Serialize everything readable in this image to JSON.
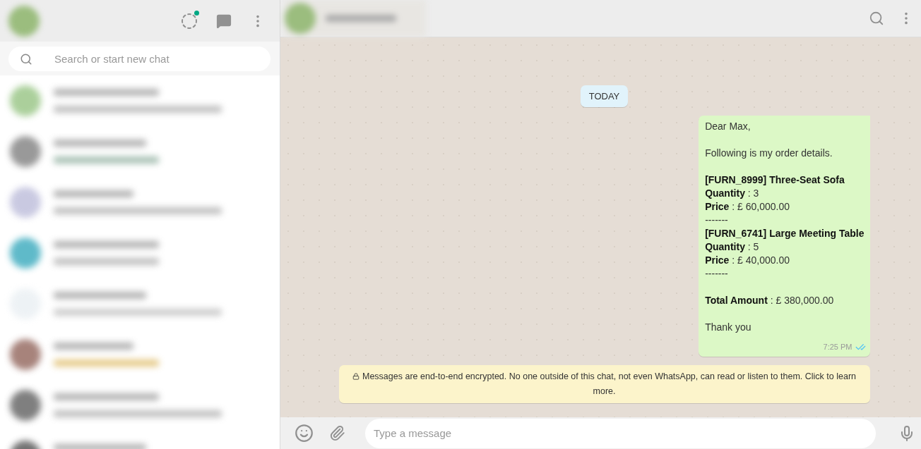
{
  "sidebar": {
    "search": {
      "placeholder": "Search or start new chat"
    },
    "status_unread": true
  },
  "chat": {
    "date_divider": "TODAY",
    "message": {
      "paragraphs": [
        [
          "Dear Max,"
        ],
        [
          "Following is my order details."
        ],
        [
          "**[FURN_8999] Three-Seat Sofa**",
          "**Quantity** : 3",
          "**Price** : £ 60,000.00",
          "-------",
          "**[FURN_6741] Large Meeting Table**",
          "**Quantity** : 5",
          "**Price** : £ 40,000.00",
          "-------"
        ],
        [
          "**Total Amount** : £ 380,000.00"
        ],
        [
          "Thank you"
        ]
      ],
      "time": "7:25 PM",
      "read": true
    },
    "encryption_notice": "Messages are end-to-end encrypted. No one outside of this chat, not even WhatsApp, can read or listen to them. Click to learn more.",
    "composer": {
      "placeholder": "Type a message"
    }
  }
}
